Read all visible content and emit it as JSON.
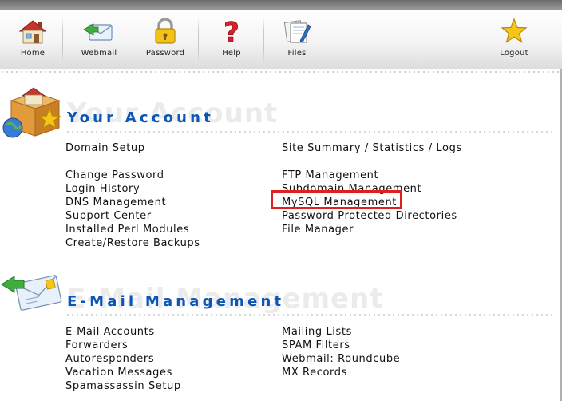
{
  "toolbar": {
    "home": "Home",
    "webmail": "Webmail",
    "password": "Password",
    "help": "Help",
    "files": "Files",
    "logout": "Logout"
  },
  "account": {
    "watermark": "Your Account",
    "title": "Your Account",
    "left_links": [
      "Domain Setup",
      "Change Password",
      "Login History",
      "DNS Management",
      "Support Center",
      "Installed Perl Modules",
      "Create/Restore Backups"
    ],
    "right_links": [
      "Site Summary / Statistics / Logs",
      "FTP Management",
      "Subdomain Management",
      "MySQL Management",
      "Password Protected Directories",
      "File Manager"
    ]
  },
  "email": {
    "watermark": "E-Mail Management",
    "title": "E-Mail Management",
    "left_links": [
      "E-Mail Accounts",
      "Forwarders",
      "Autoresponders",
      "Vacation Messages",
      "Spamassassin Setup"
    ],
    "right_links": [
      "Mailing Lists",
      "SPAM Filters",
      "Webmail: Roundcube",
      "MX Records"
    ]
  },
  "colors": {
    "title_blue": "#0b56b6",
    "highlight_red": "#e02020"
  },
  "highlighted_item": "MySQL Management"
}
